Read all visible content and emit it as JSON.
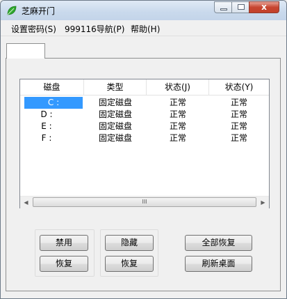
{
  "window": {
    "title": "芝麻开门",
    "close_glyph": "x",
    "icons": {
      "app": "leaf-icon",
      "minimize": "minimize-icon",
      "maximize": "maximize-icon",
      "close": "close-icon"
    }
  },
  "menu": {
    "items": [
      "设置密码(S)",
      "999116导航(P)",
      "帮助(H)"
    ]
  },
  "tab": {
    "label": ""
  },
  "list": {
    "columns": [
      "磁盘",
      "类型",
      "状态(J)",
      "状态(Y)"
    ],
    "rows": [
      {
        "disk": "C :",
        "type": "固定磁盘",
        "status_j": "正常",
        "status_y": "正常",
        "selected": true
      },
      {
        "disk": "D :",
        "type": "固定磁盘",
        "status_j": "正常",
        "status_y": "正常",
        "selected": false
      },
      {
        "disk": "E :",
        "type": "固定磁盘",
        "status_j": "正常",
        "status_y": "正常",
        "selected": false
      },
      {
        "disk": "F :",
        "type": "固定磁盘",
        "status_j": "正常",
        "status_y": "正常",
        "selected": false
      }
    ],
    "scroll": {
      "left_arrow": "◀",
      "right_arrow": "▶",
      "grip": "III"
    }
  },
  "buttons": {
    "disable": "禁用",
    "restore1": "恢复",
    "hide": "隐藏",
    "restore2": "恢复",
    "restore_all": "全部恢复",
    "refresh_desktop": "刷新桌面"
  },
  "colors": {
    "selection": "#3399ff",
    "leaf": "#2fa82f"
  }
}
